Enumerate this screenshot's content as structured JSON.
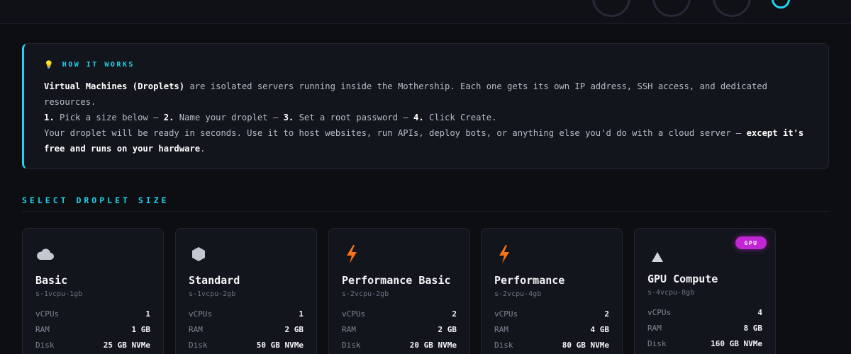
{
  "info": {
    "heading": "HOW IT WORKS",
    "line1_strong": "Virtual Machines (Droplets)",
    "line1_rest": " are isolated servers running inside the Mothership. Each one gets its own IP address, SSH access, and dedicated resources.",
    "step1_num": "1.",
    "step1_text": " Pick a size below — ",
    "step2_num": "2.",
    "step2_text": " Name your droplet — ",
    "step3_num": "3.",
    "step3_text": " Set a root password — ",
    "step4_num": "4.",
    "step4_text": " Click Create.",
    "line3_text": "Your droplet will be ready in seconds. Use it to host websites, run APIs, deploy bots, or anything else you'd do with a cloud server — ",
    "line3_strong": "except it's free and runs on your hardware",
    "line3_end": "."
  },
  "section_title": "SELECT DROPLET SIZE",
  "labels": {
    "vcpus": "vCPUs",
    "ram": "RAM",
    "disk": "Disk"
  },
  "cards": [
    {
      "name": "Basic",
      "slug": "s-1vcpu-1gb",
      "icon": "cloud-icon",
      "vcpus": "1",
      "ram": "1 GB",
      "disk": "25 GB NVMe"
    },
    {
      "name": "Standard",
      "slug": "s-1vcpu-2gb",
      "icon": "hexagon-icon",
      "vcpus": "1",
      "ram": "2 GB",
      "disk": "50 GB NVMe"
    },
    {
      "name": "Performance Basic",
      "slug": "s-2vcpu-2gb",
      "icon": "lightning-icon",
      "vcpus": "2",
      "ram": "2 GB",
      "disk": "20 GB NVMe"
    },
    {
      "name": "Performance",
      "slug": "s-2vcpu-4gb",
      "icon": "lightning-icon",
      "vcpus": "2",
      "ram": "4 GB",
      "disk": "80 GB NVMe"
    },
    {
      "name": "GPU Compute",
      "slug": "s-4vcpu-8gb",
      "icon": "triangle-icon",
      "badge": "GPU",
      "vcpus": "4",
      "ram": "8 GB",
      "disk": "160 GB NVMe"
    }
  ],
  "colors": {
    "accent": "#22d3ee",
    "gpu_badge": "#c026d3",
    "lightning": "#f97316",
    "background": "#0d0e12",
    "card": "#13151c"
  }
}
